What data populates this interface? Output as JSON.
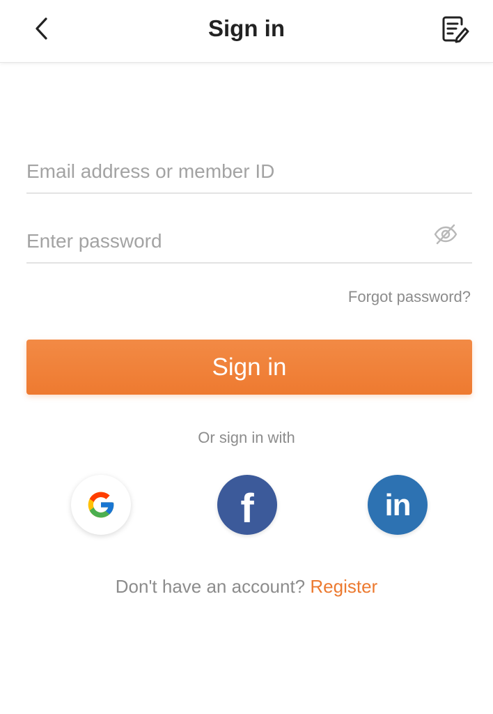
{
  "header": {
    "title": "Sign in",
    "back_icon": "chevron-left-icon",
    "action_icon": "note-edit-icon"
  },
  "form": {
    "email": {
      "value": "",
      "placeholder": "Email address or member ID"
    },
    "password": {
      "value": "",
      "placeholder": "Enter password",
      "toggle_icon": "eye-off-icon"
    },
    "forgot_label": "Forgot password?",
    "signin_label": "Sign in"
  },
  "social": {
    "label": "Or sign in with",
    "providers": [
      {
        "name": "Google",
        "icon": "google-icon",
        "glyph": "G"
      },
      {
        "name": "Facebook",
        "icon": "facebook-icon",
        "glyph": "f"
      },
      {
        "name": "LinkedIn",
        "icon": "linkedin-icon",
        "glyph": "in"
      }
    ]
  },
  "register": {
    "prompt": "Don't have an account?",
    "link": "Register"
  },
  "colors": {
    "accent": "#ee7a30",
    "facebook": "#3c5a9a",
    "linkedin": "#2d72b2",
    "muted_text": "#8c8c8c"
  }
}
